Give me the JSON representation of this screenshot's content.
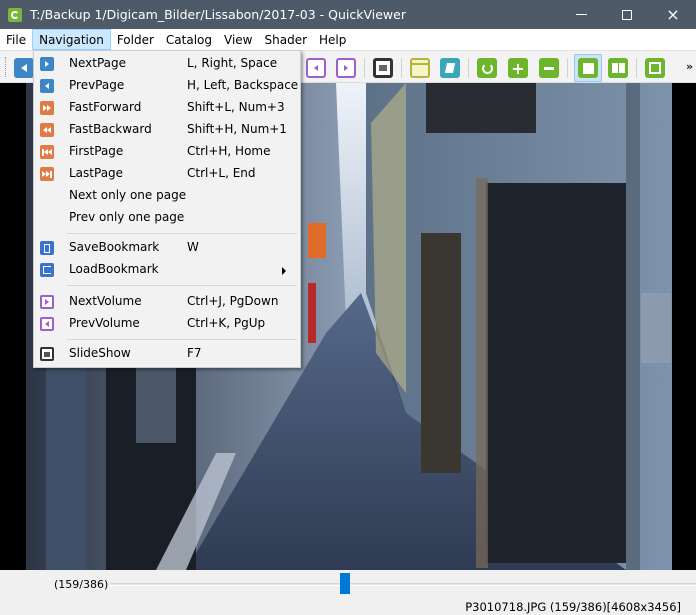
{
  "window": {
    "title": "T:/Backup 1/Digicam_Bilder/Lissabon/2017-03 - QuickViewer",
    "controls": {
      "minimize": "minimize",
      "maximize": "maximize",
      "close": "×"
    }
  },
  "menubar": {
    "items": [
      {
        "label": "File"
      },
      {
        "label": "Navigation",
        "active": true
      },
      {
        "label": "Folder"
      },
      {
        "label": "Catalog"
      },
      {
        "label": "View"
      },
      {
        "label": "Shader"
      },
      {
        "label": "Help"
      }
    ]
  },
  "toolbar": {
    "buttons": [
      {
        "icon": "prev-page-icon",
        "color": "#3d86c6"
      },
      {
        "icon": "prev-volume-icon",
        "color": "#9b5fd0"
      },
      {
        "icon": "next-volume-icon",
        "color": "#9b5fd0"
      },
      {
        "icon": "slideshow-icon",
        "color": "#333333"
      },
      {
        "icon": "open-folder-icon",
        "color": "#b5b53a"
      },
      {
        "icon": "catalog-icon",
        "color": "#3aa6b9"
      },
      {
        "icon": "rotate-icon",
        "color": "#6cb52d"
      },
      {
        "icon": "zoom-in-icon",
        "color": "#6cb52d"
      },
      {
        "icon": "zoom-out-icon",
        "color": "#6cb52d"
      },
      {
        "icon": "single-page-icon",
        "color": "#6cb52d",
        "pressed": true
      },
      {
        "icon": "dual-page-icon",
        "color": "#6cb52d"
      },
      {
        "icon": "fullscreen-icon",
        "color": "#6cb52d"
      }
    ],
    "overflow": "»"
  },
  "navigation_menu": {
    "items": [
      {
        "label": "NextPage",
        "shortcut": "L, Right, Space",
        "icon": "next-page-icon",
        "color": "#3d86c6"
      },
      {
        "label": "PrevPage",
        "shortcut": "H, Left, Backspace",
        "icon": "prev-page-icon",
        "color": "#3d86c6"
      },
      {
        "label": "FastForward",
        "shortcut": "Shift+L, Num+3",
        "icon": "fast-forward-icon",
        "color": "#e07b45"
      },
      {
        "label": "FastBackward",
        "shortcut": "Shift+H, Num+1",
        "icon": "fast-backward-icon",
        "color": "#e07b45"
      },
      {
        "label": "FirstPage",
        "shortcut": "Ctrl+H, Home",
        "icon": "first-page-icon",
        "color": "#e07b45"
      },
      {
        "label": "LastPage",
        "shortcut": "Ctrl+L, End",
        "icon": "last-page-icon",
        "color": "#e07b45"
      },
      {
        "label": "Next only one page",
        "shortcut": ""
      },
      {
        "label": "Prev only one page",
        "shortcut": ""
      },
      {
        "label": "SaveBookmark",
        "shortcut": "W",
        "icon": "save-bookmark-icon",
        "color": "#3a73c9"
      },
      {
        "label": "LoadBookmark",
        "shortcut": "",
        "icon": "load-bookmark-icon",
        "color": "#3a73c9",
        "submenu": true
      },
      {
        "label": "NextVolume",
        "shortcut": "Ctrl+J, PgDown",
        "icon": "next-volume-icon",
        "color": "#9b5fd0"
      },
      {
        "label": "PrevVolume",
        "shortcut": "Ctrl+K, PgUp",
        "icon": "prev-volume-icon",
        "color": "#9b5fd0"
      },
      {
        "label": "SlideShow",
        "shortcut": "F7",
        "icon": "slideshow-icon",
        "color": "#333333"
      }
    ]
  },
  "seekbar": {
    "label": "(159/386)",
    "current": 159,
    "total": 386
  },
  "statusbar": {
    "text": "P3010718.JPG (159/386)[4608x3456]"
  },
  "colors": {
    "titlebar": "#4e5a67",
    "menu_active": "#cce8ff",
    "slider_thumb": "#0078d7"
  }
}
